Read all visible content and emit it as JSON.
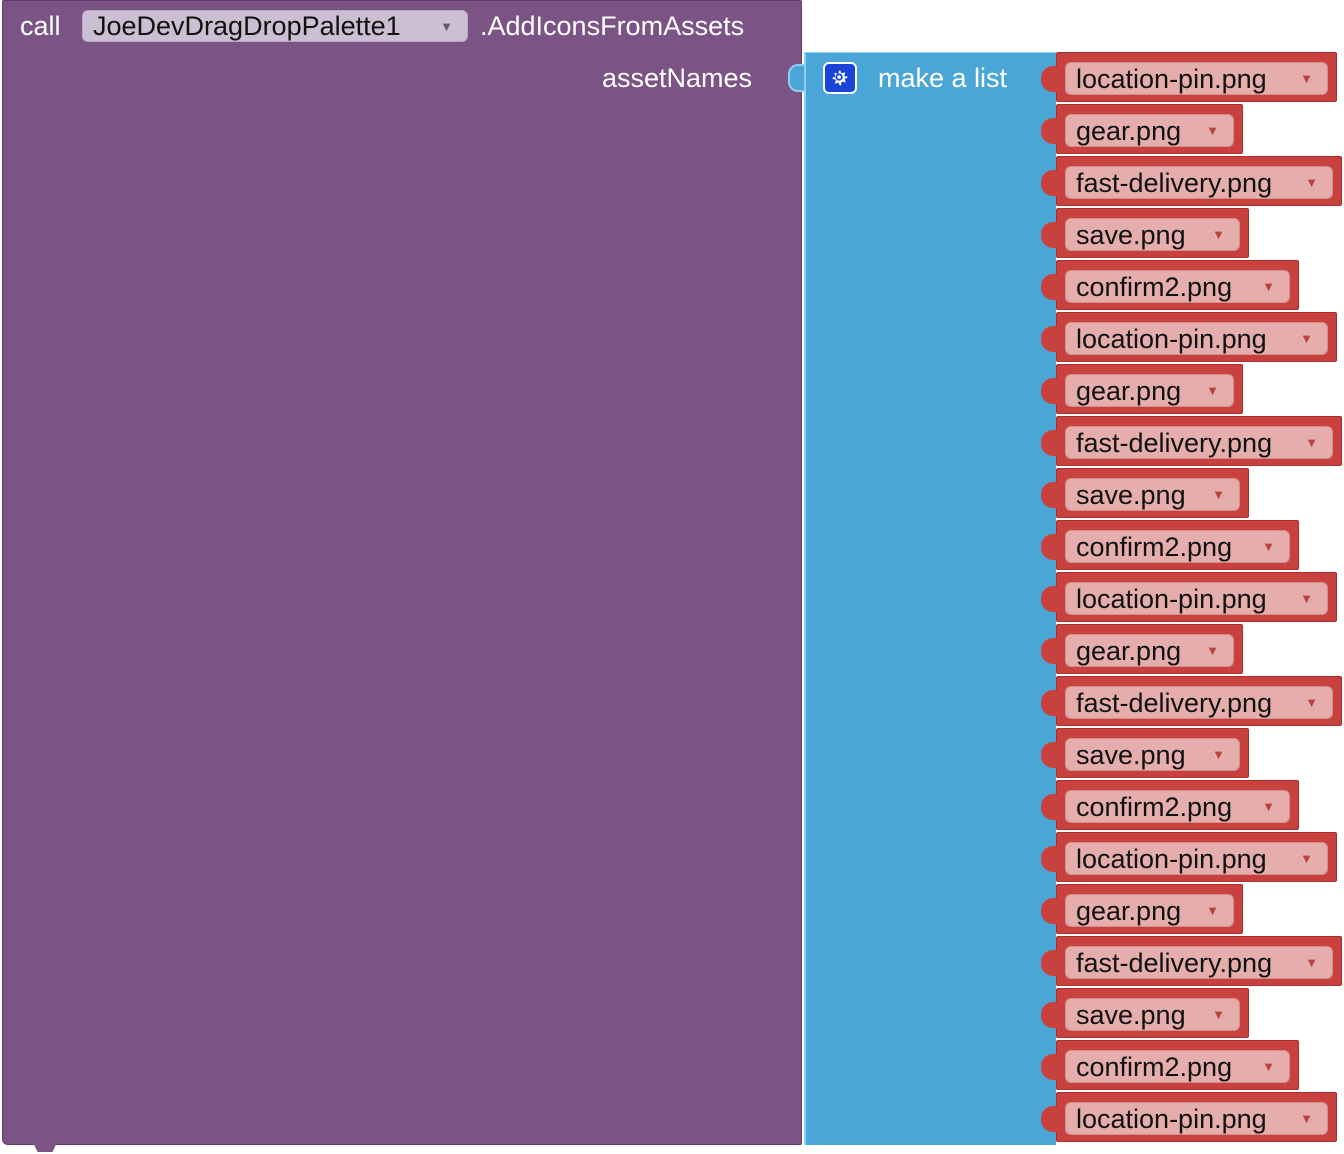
{
  "call_block": {
    "keyword": "call",
    "component": "JoeDevDragDropPalette1",
    "method": ".AddIconsFromAssets",
    "parameter": "assetNames",
    "color": "#7b5384"
  },
  "list_block": {
    "label": "make a list",
    "icon": "gear-icon",
    "color": "#4aa6d6"
  },
  "dropdown_arrow": "▼",
  "items": [
    "location-pin.png",
    "gear.png",
    "fast-delivery.png",
    "save.png",
    "confirm2.png",
    "location-pin.png",
    "gear.png",
    "fast-delivery.png",
    "save.png",
    "confirm2.png",
    "location-pin.png",
    "gear.png",
    "fast-delivery.png",
    "save.png",
    "confirm2.png",
    "location-pin.png",
    "gear.png",
    "fast-delivery.png",
    "save.png",
    "confirm2.png",
    "location-pin.png"
  ],
  "item_color": "#c8413f"
}
